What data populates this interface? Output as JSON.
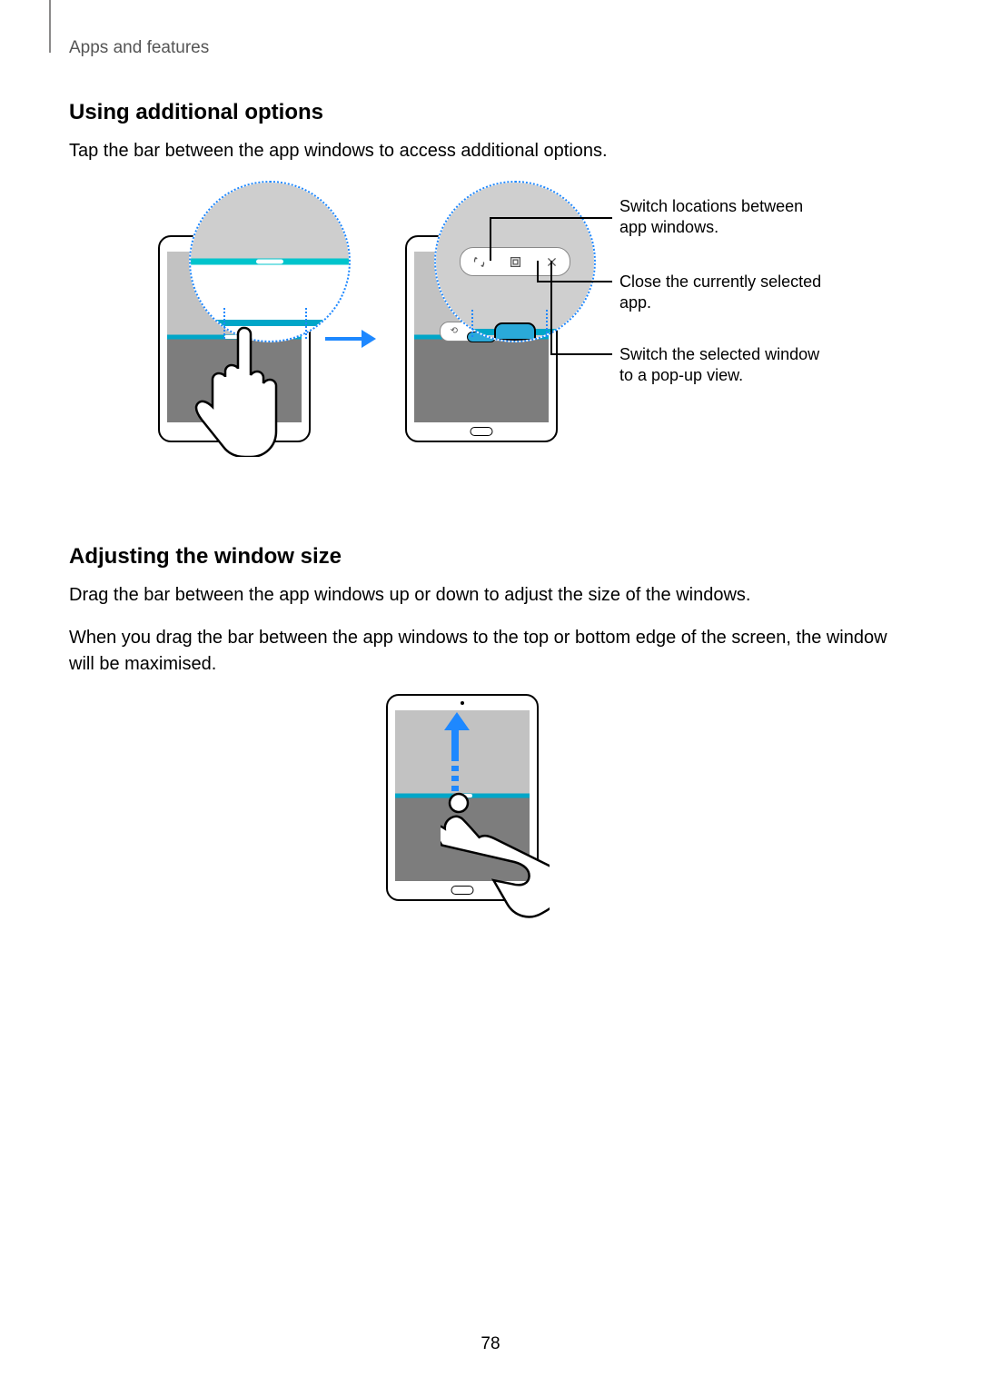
{
  "breadcrumb": "Apps and features",
  "page_number": "78",
  "section1": {
    "heading": "Using additional options",
    "body": "Tap the bar between the app windows to access additional options.",
    "annotations": {
      "a1": "Switch locations between app windows.",
      "a2": "Close the currently selected app.",
      "a3": "Switch the selected window to a pop-up view."
    }
  },
  "section2": {
    "heading": "Adjusting the window size",
    "body1": "Drag the bar between the app windows up or down to adjust the size of the windows.",
    "body2": "When you drag the bar between the app windows to the top or bottom edge of the screen, the window will be maximised."
  }
}
